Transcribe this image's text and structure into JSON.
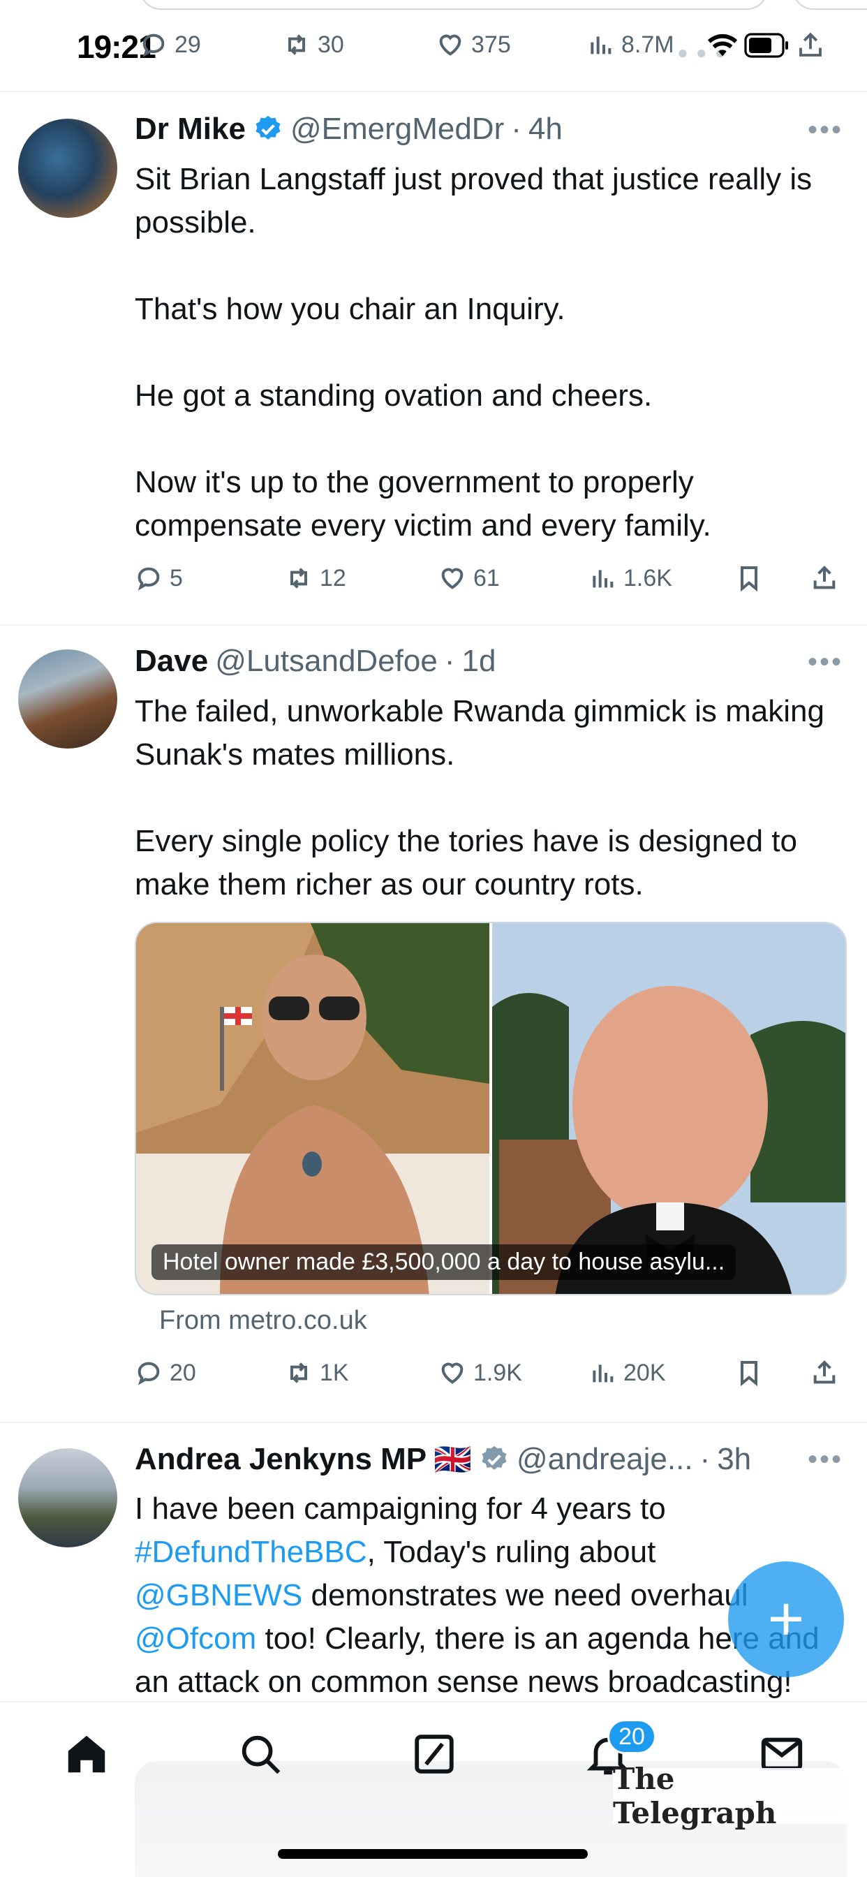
{
  "status_bar": {
    "time": "19:21"
  },
  "top_action_row": {
    "replies": "29",
    "reposts": "30",
    "likes": "375",
    "views": "8.7M"
  },
  "tweets": [
    {
      "name": "Dr Mike",
      "verified": true,
      "handle": "@EmergMedDr",
      "time": "4h",
      "paragraphs": [
        "Sit Brian Langstaff just proved that justice really is possible.",
        "That's how you chair an Inquiry.",
        "He got a standing ovation and cheers.",
        "Now it's up to the government to properly compensate every victim and every family."
      ],
      "replies": "5",
      "reposts": "12",
      "likes": "61",
      "views": "1.6K"
    },
    {
      "name": "Dave",
      "verified": false,
      "handle": "@LutsandDefoe",
      "time": "1d",
      "paragraphs": [
        "The failed, unworkable Rwanda gimmick is making Sunak's mates millions.",
        "Every single policy the tories have is designed to make them richer as our country rots."
      ],
      "card": {
        "caption": "Hotel owner made £3,500,000 a day to house asylu...",
        "source": "From metro.co.uk"
      },
      "replies": "20",
      "reposts": "1K",
      "likes": "1.9K",
      "views": "20K"
    },
    {
      "name": "Andrea Jenkyns MP",
      "flag": "🇬🇧",
      "verified": true,
      "handle": "@andreaje...",
      "time": "3h",
      "body": {
        "t1": "I have been campaigning for 4 years to ",
        "l1": "#DefundTheBBC",
        "t2": ", Today's ruling about ",
        "l2": "@GBNEWS",
        "t3": " demonstrates we need overhaul ",
        "l3": "@Ofcom",
        "t4": " too! Clearly, there is an agenda here and an attack on common sense news broadcasting!"
      },
      "media_label": "The Telegraph"
    }
  ],
  "notifications_badge": "20",
  "colors": {
    "accent": "#1d9bf0",
    "text": "#0f1419",
    "secondary": "#536471"
  }
}
